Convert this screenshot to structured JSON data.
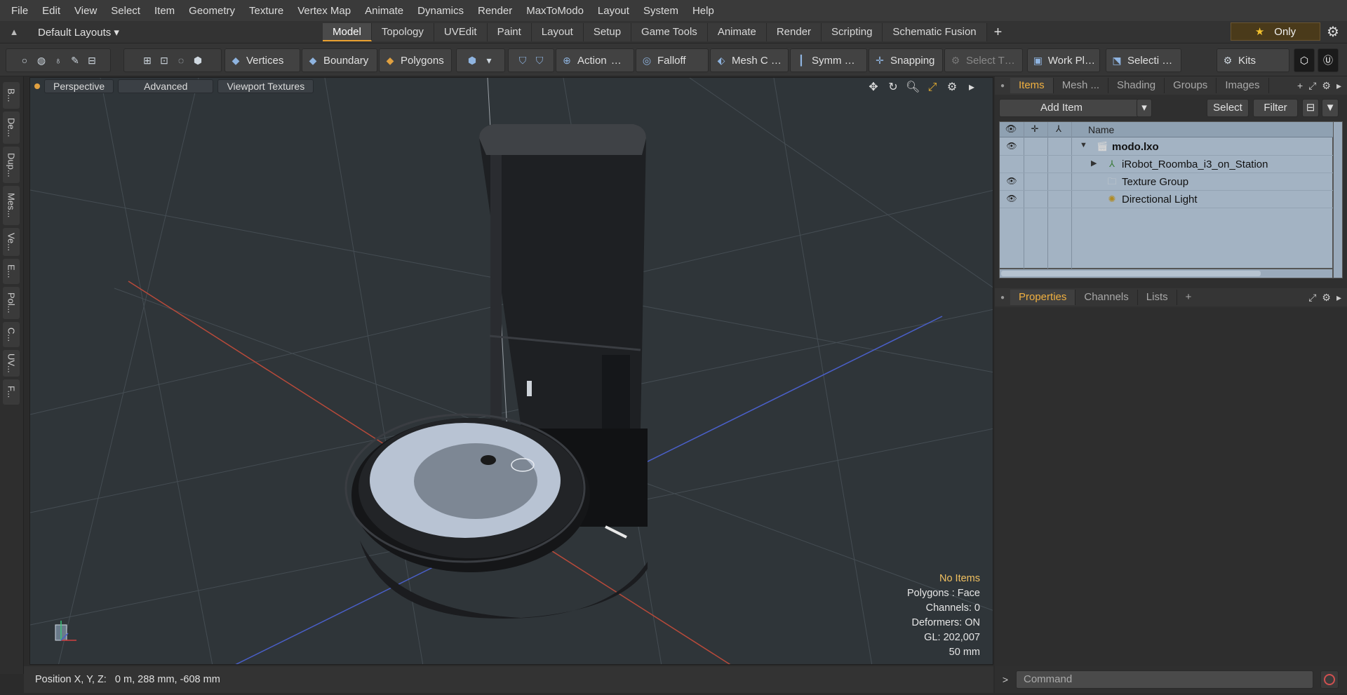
{
  "menubar": {
    "items": [
      "File",
      "Edit",
      "View",
      "Select",
      "Item",
      "Geometry",
      "Texture",
      "Vertex Map",
      "Animate",
      "Dynamics",
      "Render",
      "MaxToModo",
      "Layout",
      "System",
      "Help"
    ]
  },
  "layoutbar": {
    "default_layouts": "Default Layouts ▾",
    "tabs": [
      "Model",
      "Topology",
      "UVEdit",
      "Paint",
      "Layout",
      "Setup",
      "Game Tools",
      "Animate",
      "Render",
      "Scripting",
      "Schematic Fusion"
    ],
    "active_tab": "Model",
    "only_label": "Only"
  },
  "toolbar": {
    "vertices": "Vertices",
    "boundary": "Boundary",
    "polygons": "Polygons",
    "action": "Action",
    "action_more": "…",
    "falloff": "Falloff",
    "mesh_c": "Mesh C …",
    "symm": "Symm …",
    "snapping": "Snapping",
    "select_t": "Select T…",
    "work_pl": "Work Pl…",
    "selecti": "Selecti …",
    "kits": "Kits"
  },
  "left_strip": {
    "tabs": [
      "B...",
      "De...",
      "Dup...",
      "Mes...",
      "Ve...",
      "E...",
      "Pol...",
      "C...",
      "UV...",
      "F..."
    ]
  },
  "viewport": {
    "perspective": "Perspective",
    "advanced": "Advanced",
    "viewport_textures": "Viewport Textures",
    "stats": {
      "selection": "No Items",
      "polygons": "Polygons : Face",
      "channels": "Channels: 0",
      "deformers": "Deformers: ON",
      "gl": "GL: 202,007",
      "scale": "50 mm"
    }
  },
  "statusbar": {
    "position": "Position X, Y, Z:   0 m, 288 mm, -608 mm"
  },
  "items_panel": {
    "tabs": [
      "Items",
      "Mesh ...",
      "Shading",
      "Groups",
      "Images"
    ],
    "active_tab": "Items",
    "add_item": "Add Item",
    "select": "Select",
    "filter": "Filter",
    "column_name": "Name",
    "rows": [
      {
        "label": "modo.lxo",
        "bold": true
      },
      {
        "label": "iRobot_Roomba_i3_on_Station",
        "bold": false
      },
      {
        "label": "Texture Group",
        "bold": false
      },
      {
        "label": "Directional Light",
        "bold": false
      }
    ]
  },
  "properties_panel": {
    "tabs": [
      "Properties",
      "Channels",
      "Lists"
    ],
    "active_tab": "Properties"
  },
  "command": {
    "placeholder": "Command"
  },
  "colors": {
    "accent": "#e8a030",
    "viewport_bg": "#2f3539",
    "item_list_bg": "#a3b3c3"
  }
}
